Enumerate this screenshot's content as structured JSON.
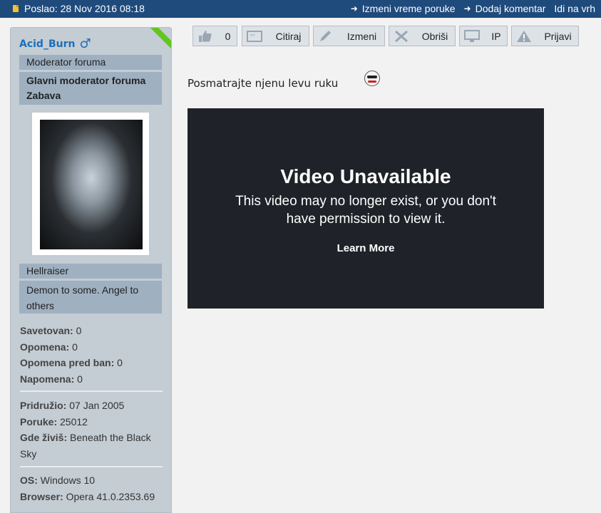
{
  "topbar": {
    "posted": "Poslao: 28 Nov 2016 08:18",
    "links": [
      "Izmeni vreme poruke",
      "Dodaj komentar",
      "Idi na vrh"
    ]
  },
  "user": {
    "name": "Acid_Burn",
    "gender_symbol": "♂",
    "ranks": [
      "Moderator foruma",
      "Glavni moderator foruma Zabava"
    ],
    "title": "Hellraiser",
    "motto": "Demon to some. Angel to others",
    "stats": [
      {
        "label": "Savetovan:",
        "value": "0"
      },
      {
        "label": "Opomena:",
        "value": "0"
      },
      {
        "label": "Opomena pred ban:",
        "value": "0"
      },
      {
        "label": "Napomena:",
        "value": "0"
      }
    ],
    "info": [
      {
        "label": "Pridružio:",
        "value": "07 Jan 2005"
      },
      {
        "label": "Poruke:",
        "value": "25012"
      },
      {
        "label": "Gde živiš:",
        "value": "Beneath the Black Sky"
      }
    ],
    "system": [
      {
        "label": "OS:",
        "value": "Windows 10"
      },
      {
        "label": "Browser:",
        "value": "Opera 41.0.2353.69"
      }
    ]
  },
  "actions": {
    "like_count": "0",
    "quote": "Citiraj",
    "edit": "Izmeni",
    "delete": "Obriši",
    "ip": "IP",
    "report": "Prijavi"
  },
  "post": {
    "text": "Posmatrajte njenu levu ruku"
  },
  "video": {
    "title": "Video Unavailable",
    "message": "This video may no longer exist, or you don't have permission to view it.",
    "learn_more": "Learn More"
  },
  "colors": {
    "topbar": "#1f4a7c",
    "username": "#1e6fb8",
    "ribbon": "#63c51e"
  },
  "icons": [
    "note-icon",
    "arrow-right-icon",
    "male-icon",
    "thumbs-up-icon",
    "quote-icon",
    "pencil-icon",
    "cross-icon",
    "monitor-icon",
    "warning-icon",
    "smiley-icon"
  ]
}
